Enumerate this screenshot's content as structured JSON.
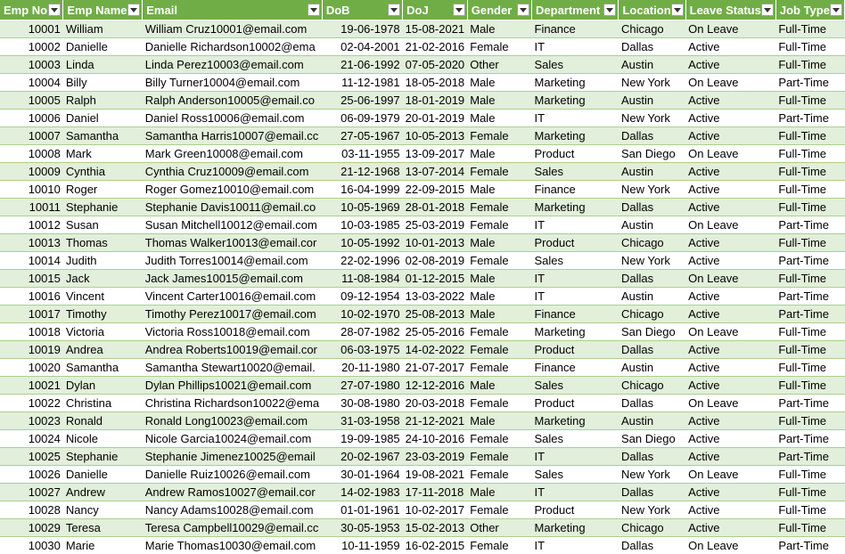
{
  "columns": [
    "Emp No",
    "Emp Name",
    "Email",
    "DoB",
    "DoJ",
    "Gender",
    "Department",
    "Location",
    "Leave Status",
    "Job Type"
  ],
  "rows": [
    [
      "10001",
      "William",
      "William Cruz10001@email.com",
      "19-06-1978",
      "15-08-2021",
      "Male",
      "Finance",
      "Chicago",
      "On Leave",
      "Full-Time"
    ],
    [
      "10002",
      "Danielle",
      "Danielle Richardson10002@ema",
      "02-04-2001",
      "21-02-2016",
      "Female",
      "IT",
      "Dallas",
      "Active",
      "Full-Time"
    ],
    [
      "10003",
      "Linda",
      "Linda Perez10003@email.com",
      "21-06-1992",
      "07-05-2020",
      "Other",
      "Sales",
      "Austin",
      "Active",
      "Full-Time"
    ],
    [
      "10004",
      "Billy",
      "Billy Turner10004@email.com",
      "11-12-1981",
      "18-05-2018",
      "Male",
      "Marketing",
      "New York",
      "On Leave",
      "Part-Time"
    ],
    [
      "10005",
      "Ralph",
      "Ralph Anderson10005@email.co",
      "25-06-1997",
      "18-01-2019",
      "Male",
      "Marketing",
      "Austin",
      "Active",
      "Full-Time"
    ],
    [
      "10006",
      "Daniel",
      "Daniel Ross10006@email.com",
      "06-09-1979",
      "20-01-2019",
      "Male",
      "IT",
      "New York",
      "Active",
      "Part-Time"
    ],
    [
      "10007",
      "Samantha",
      "Samantha Harris10007@email.cc",
      "27-05-1967",
      "10-05-2013",
      "Female",
      "Marketing",
      "Dallas",
      "Active",
      "Full-Time"
    ],
    [
      "10008",
      "Mark",
      "Mark Green10008@email.com",
      "03-11-1955",
      "13-09-2017",
      "Male",
      "Product",
      "San Diego",
      "On Leave",
      "Full-Time"
    ],
    [
      "10009",
      "Cynthia",
      "Cynthia Cruz10009@email.com",
      "21-12-1968",
      "13-07-2014",
      "Female",
      "Sales",
      "Austin",
      "Active",
      "Full-Time"
    ],
    [
      "10010",
      "Roger",
      "Roger Gomez10010@email.com",
      "16-04-1999",
      "22-09-2015",
      "Male",
      "Finance",
      "New York",
      "Active",
      "Full-Time"
    ],
    [
      "10011",
      "Stephanie",
      "Stephanie Davis10011@email.co",
      "10-05-1969",
      "28-01-2018",
      "Female",
      "Marketing",
      "Dallas",
      "Active",
      "Full-Time"
    ],
    [
      "10012",
      "Susan",
      "Susan Mitchell10012@email.com",
      "10-03-1985",
      "25-03-2019",
      "Female",
      "IT",
      "Austin",
      "On Leave",
      "Part-Time"
    ],
    [
      "10013",
      "Thomas",
      "Thomas Walker10013@email.cor",
      "10-05-1992",
      "10-01-2013",
      "Male",
      "Product",
      "Chicago",
      "Active",
      "Full-Time"
    ],
    [
      "10014",
      "Judith",
      "Judith Torres10014@email.com",
      "22-02-1996",
      "02-08-2019",
      "Female",
      "Sales",
      "New York",
      "Active",
      "Part-Time"
    ],
    [
      "10015",
      "Jack",
      "Jack James10015@email.com",
      "11-08-1984",
      "01-12-2015",
      "Male",
      "IT",
      "Dallas",
      "On Leave",
      "Full-Time"
    ],
    [
      "10016",
      "Vincent",
      "Vincent Carter10016@email.com",
      "09-12-1954",
      "13-03-2022",
      "Male",
      "IT",
      "Austin",
      "Active",
      "Part-Time"
    ],
    [
      "10017",
      "Timothy",
      "Timothy Perez10017@email.com",
      "10-02-1970",
      "25-08-2013",
      "Male",
      "Finance",
      "Chicago",
      "Active",
      "Part-Time"
    ],
    [
      "10018",
      "Victoria",
      "Victoria Ross10018@email.com",
      "28-07-1982",
      "25-05-2016",
      "Female",
      "Marketing",
      "San Diego",
      "On Leave",
      "Full-Time"
    ],
    [
      "10019",
      "Andrea",
      "Andrea Roberts10019@email.cor",
      "06-03-1975",
      "14-02-2022",
      "Female",
      "Product",
      "Dallas",
      "Active",
      "Full-Time"
    ],
    [
      "10020",
      "Samantha",
      "Samantha Stewart10020@email.",
      "20-11-1980",
      "21-07-2017",
      "Female",
      "Finance",
      "Austin",
      "Active",
      "Full-Time"
    ],
    [
      "10021",
      "Dylan",
      "Dylan Phillips10021@email.com",
      "27-07-1980",
      "12-12-2016",
      "Male",
      "Sales",
      "Chicago",
      "Active",
      "Full-Time"
    ],
    [
      "10022",
      "Christina",
      "Christina Richardson10022@ema",
      "30-08-1980",
      "20-03-2018",
      "Female",
      "Product",
      "Dallas",
      "On Leave",
      "Part-Time"
    ],
    [
      "10023",
      "Ronald",
      "Ronald Long10023@email.com",
      "31-03-1958",
      "21-12-2021",
      "Male",
      "Marketing",
      "Austin",
      "Active",
      "Full-Time"
    ],
    [
      "10024",
      "Nicole",
      "Nicole Garcia10024@email.com",
      "19-09-1985",
      "24-10-2016",
      "Female",
      "Sales",
      "San Diego",
      "Active",
      "Part-Time"
    ],
    [
      "10025",
      "Stephanie",
      "Stephanie Jimenez10025@email",
      "20-02-1967",
      "23-03-2019",
      "Female",
      "IT",
      "Dallas",
      "Active",
      "Part-Time"
    ],
    [
      "10026",
      "Danielle",
      "Danielle Ruiz10026@email.com",
      "30-01-1964",
      "19-08-2021",
      "Female",
      "Sales",
      "New York",
      "On Leave",
      "Full-Time"
    ],
    [
      "10027",
      "Andrew",
      "Andrew Ramos10027@email.cor",
      "14-02-1983",
      "17-11-2018",
      "Male",
      "IT",
      "Dallas",
      "Active",
      "Full-Time"
    ],
    [
      "10028",
      "Nancy",
      "Nancy Adams10028@email.com",
      "01-01-1961",
      "10-02-2017",
      "Female",
      "Product",
      "New York",
      "Active",
      "Full-Time"
    ],
    [
      "10029",
      "Teresa",
      "Teresa Campbell10029@email.cc",
      "30-05-1953",
      "15-02-2013",
      "Other",
      "Marketing",
      "Chicago",
      "Active",
      "Full-Time"
    ],
    [
      "10030",
      "Marie",
      "Marie Thomas10030@email.com",
      "10-11-1959",
      "16-02-2015",
      "Female",
      "IT",
      "Dallas",
      "On Leave",
      "Part-Time"
    ]
  ],
  "colors": {
    "header_bg": "#70ad47",
    "band": "#e2efda",
    "rule": "#a9d08e"
  },
  "icons": {
    "filter": "filter-dropdown-icon"
  }
}
